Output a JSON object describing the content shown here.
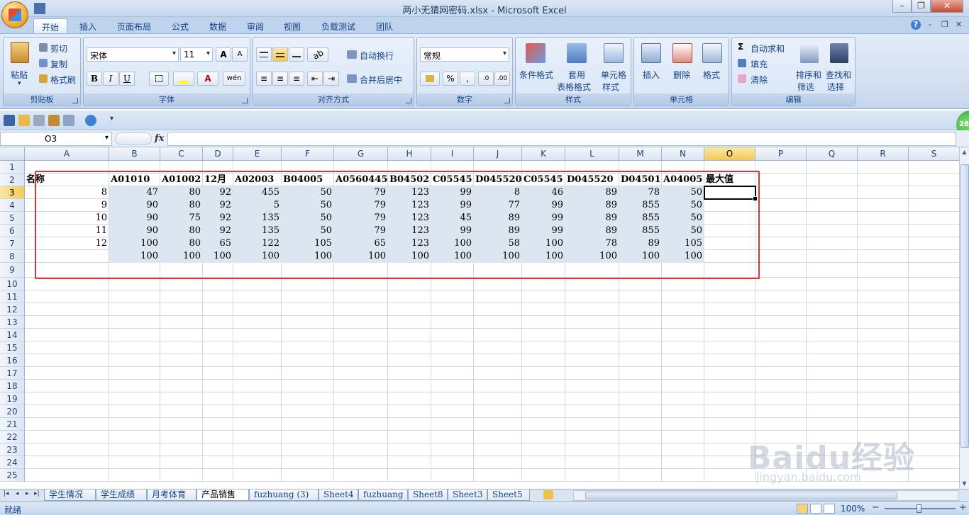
{
  "window": {
    "title": "两小无猜网密码.xlsx - Microsoft Excel",
    "min": "–",
    "restore": "❐",
    "close": "✕"
  },
  "ribbon_tabs": [
    "开始",
    "插入",
    "页面布局",
    "公式",
    "数据",
    "审阅",
    "视图",
    "负载测试",
    "团队"
  ],
  "ribbon_tabs_right": [
    "?",
    "–",
    "❐",
    "✕"
  ],
  "clipboard": {
    "title": "剪贴板",
    "paste": "粘贴",
    "cut": "剪切",
    "copy": "复制",
    "format_painter": "格式刷"
  },
  "font": {
    "title": "字体",
    "name": "宋体",
    "size": "11",
    "grow": "A",
    "shrink": "A",
    "bold": "B",
    "italic": "I",
    "underline": "U",
    "color_a": "A",
    "phonetic": "wén"
  },
  "alignment": {
    "title": "对齐方式",
    "wrap": "自动换行",
    "merge": "合并后居中"
  },
  "number": {
    "title": "数字",
    "format": "常规",
    "percent": "%",
    "comma": ",",
    "inc": ".0",
    "dec": ".00"
  },
  "styles": {
    "title": "样式",
    "conditional": "条件格式",
    "table1": "套用",
    "table2": "表格格式",
    "cell1": "单元格",
    "cell2": "样式"
  },
  "cells": {
    "title": "单元格",
    "insert": "插入",
    "delete": "删除",
    "format": "格式"
  },
  "editing": {
    "title": "编辑",
    "autosum": "自动求和",
    "fill": "填充",
    "clear": "清除",
    "sort1": "排序和",
    "sort2": "筛选",
    "find1": "查找和",
    "find2": "选择"
  },
  "namebox": "O3",
  "fx": "fx",
  "badge": "28",
  "columns": [
    "A",
    "B",
    "C",
    "D",
    "E",
    "F",
    "G",
    "H",
    "I",
    "J",
    "K",
    "L",
    "M",
    "N",
    "O",
    "P",
    "Q",
    "R",
    "S"
  ],
  "rows": [
    "1",
    "2",
    "3",
    "4",
    "5",
    "6",
    "7",
    "8",
    "9",
    "10",
    "11",
    "12",
    "13",
    "14",
    "15",
    "16",
    "17",
    "18",
    "19",
    "20",
    "21",
    "22",
    "23",
    "24",
    "25"
  ],
  "sheet": {
    "header": [
      "名称",
      "A01010",
      "A01002",
      "12月",
      "A02003",
      "B04005",
      "A0560445",
      "B04502",
      "C05545",
      "D045520",
      "C05545",
      "D045520",
      "D04501",
      "A04005",
      "最大值"
    ],
    "data": [
      [
        "8",
        "47",
        "80",
        "92",
        "455",
        "50",
        "79",
        "123",
        "99",
        "8",
        "46",
        "89",
        "78",
        "50"
      ],
      [
        "9",
        "90",
        "80",
        "92",
        "5",
        "50",
        "79",
        "123",
        "99",
        "77",
        "99",
        "89",
        "855",
        "50"
      ],
      [
        "10",
        "90",
        "75",
        "92",
        "135",
        "50",
        "79",
        "123",
        "45",
        "89",
        "99",
        "89",
        "855",
        "50"
      ],
      [
        "11",
        "90",
        "80",
        "92",
        "135",
        "50",
        "79",
        "123",
        "99",
        "89",
        "99",
        "89",
        "855",
        "50"
      ],
      [
        "12",
        "100",
        "80",
        "65",
        "122",
        "105",
        "65",
        "123",
        "100",
        "58",
        "100",
        "78",
        "89",
        "105"
      ],
      [
        "",
        "100",
        "100",
        "100",
        "100",
        "100",
        "100",
        "100",
        "100",
        "100",
        "100",
        "100",
        "100",
        "100"
      ]
    ]
  },
  "sheet_tabs": [
    "学生情况",
    "学生成绩",
    "月考体育",
    "产品销售",
    "fuzhuang (3)",
    "Sheet4",
    "fuzhuang",
    "Sheet8",
    "Sheet3",
    "Sheet5"
  ],
  "active_sheet": "产品销售",
  "nav": [
    "|◂",
    "◂",
    "▸",
    "▸|"
  ],
  "status": "就绪",
  "zoom": "100%",
  "zoom_minus": "−",
  "zoom_plus": "+",
  "watermark": {
    "text": "Baidu经验",
    "url": "jingyan.baidu.com"
  }
}
